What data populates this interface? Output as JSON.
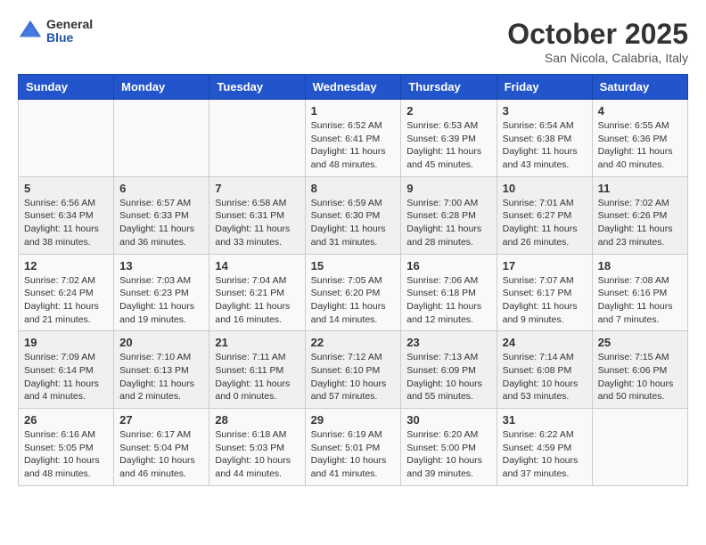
{
  "header": {
    "logo": {
      "general": "General",
      "blue": "Blue"
    },
    "title": "October 2025",
    "location": "San Nicola, Calabria, Italy"
  },
  "weekdays": [
    "Sunday",
    "Monday",
    "Tuesday",
    "Wednesday",
    "Thursday",
    "Friday",
    "Saturday"
  ],
  "weeks": [
    [
      {
        "day": "",
        "info": ""
      },
      {
        "day": "",
        "info": ""
      },
      {
        "day": "",
        "info": ""
      },
      {
        "day": "1",
        "info": "Sunrise: 6:52 AM\nSunset: 6:41 PM\nDaylight: 11 hours\nand 48 minutes."
      },
      {
        "day": "2",
        "info": "Sunrise: 6:53 AM\nSunset: 6:39 PM\nDaylight: 11 hours\nand 45 minutes."
      },
      {
        "day": "3",
        "info": "Sunrise: 6:54 AM\nSunset: 6:38 PM\nDaylight: 11 hours\nand 43 minutes."
      },
      {
        "day": "4",
        "info": "Sunrise: 6:55 AM\nSunset: 6:36 PM\nDaylight: 11 hours\nand 40 minutes."
      }
    ],
    [
      {
        "day": "5",
        "info": "Sunrise: 6:56 AM\nSunset: 6:34 PM\nDaylight: 11 hours\nand 38 minutes."
      },
      {
        "day": "6",
        "info": "Sunrise: 6:57 AM\nSunset: 6:33 PM\nDaylight: 11 hours\nand 36 minutes."
      },
      {
        "day": "7",
        "info": "Sunrise: 6:58 AM\nSunset: 6:31 PM\nDaylight: 11 hours\nand 33 minutes."
      },
      {
        "day": "8",
        "info": "Sunrise: 6:59 AM\nSunset: 6:30 PM\nDaylight: 11 hours\nand 31 minutes."
      },
      {
        "day": "9",
        "info": "Sunrise: 7:00 AM\nSunset: 6:28 PM\nDaylight: 11 hours\nand 28 minutes."
      },
      {
        "day": "10",
        "info": "Sunrise: 7:01 AM\nSunset: 6:27 PM\nDaylight: 11 hours\nand 26 minutes."
      },
      {
        "day": "11",
        "info": "Sunrise: 7:02 AM\nSunset: 6:26 PM\nDaylight: 11 hours\nand 23 minutes."
      }
    ],
    [
      {
        "day": "12",
        "info": "Sunrise: 7:02 AM\nSunset: 6:24 PM\nDaylight: 11 hours\nand 21 minutes."
      },
      {
        "day": "13",
        "info": "Sunrise: 7:03 AM\nSunset: 6:23 PM\nDaylight: 11 hours\nand 19 minutes."
      },
      {
        "day": "14",
        "info": "Sunrise: 7:04 AM\nSunset: 6:21 PM\nDaylight: 11 hours\nand 16 minutes."
      },
      {
        "day": "15",
        "info": "Sunrise: 7:05 AM\nSunset: 6:20 PM\nDaylight: 11 hours\nand 14 minutes."
      },
      {
        "day": "16",
        "info": "Sunrise: 7:06 AM\nSunset: 6:18 PM\nDaylight: 11 hours\nand 12 minutes."
      },
      {
        "day": "17",
        "info": "Sunrise: 7:07 AM\nSunset: 6:17 PM\nDaylight: 11 hours\nand 9 minutes."
      },
      {
        "day": "18",
        "info": "Sunrise: 7:08 AM\nSunset: 6:16 PM\nDaylight: 11 hours\nand 7 minutes."
      }
    ],
    [
      {
        "day": "19",
        "info": "Sunrise: 7:09 AM\nSunset: 6:14 PM\nDaylight: 11 hours\nand 4 minutes."
      },
      {
        "day": "20",
        "info": "Sunrise: 7:10 AM\nSunset: 6:13 PM\nDaylight: 11 hours\nand 2 minutes."
      },
      {
        "day": "21",
        "info": "Sunrise: 7:11 AM\nSunset: 6:11 PM\nDaylight: 11 hours\nand 0 minutes."
      },
      {
        "day": "22",
        "info": "Sunrise: 7:12 AM\nSunset: 6:10 PM\nDaylight: 10 hours\nand 57 minutes."
      },
      {
        "day": "23",
        "info": "Sunrise: 7:13 AM\nSunset: 6:09 PM\nDaylight: 10 hours\nand 55 minutes."
      },
      {
        "day": "24",
        "info": "Sunrise: 7:14 AM\nSunset: 6:08 PM\nDaylight: 10 hours\nand 53 minutes."
      },
      {
        "day": "25",
        "info": "Sunrise: 7:15 AM\nSunset: 6:06 PM\nDaylight: 10 hours\nand 50 minutes."
      }
    ],
    [
      {
        "day": "26",
        "info": "Sunrise: 6:16 AM\nSunset: 5:05 PM\nDaylight: 10 hours\nand 48 minutes."
      },
      {
        "day": "27",
        "info": "Sunrise: 6:17 AM\nSunset: 5:04 PM\nDaylight: 10 hours\nand 46 minutes."
      },
      {
        "day": "28",
        "info": "Sunrise: 6:18 AM\nSunset: 5:03 PM\nDaylight: 10 hours\nand 44 minutes."
      },
      {
        "day": "29",
        "info": "Sunrise: 6:19 AM\nSunset: 5:01 PM\nDaylight: 10 hours\nand 41 minutes."
      },
      {
        "day": "30",
        "info": "Sunrise: 6:20 AM\nSunset: 5:00 PM\nDaylight: 10 hours\nand 39 minutes."
      },
      {
        "day": "31",
        "info": "Sunrise: 6:22 AM\nSunset: 4:59 PM\nDaylight: 10 hours\nand 37 minutes."
      },
      {
        "day": "",
        "info": ""
      }
    ]
  ]
}
